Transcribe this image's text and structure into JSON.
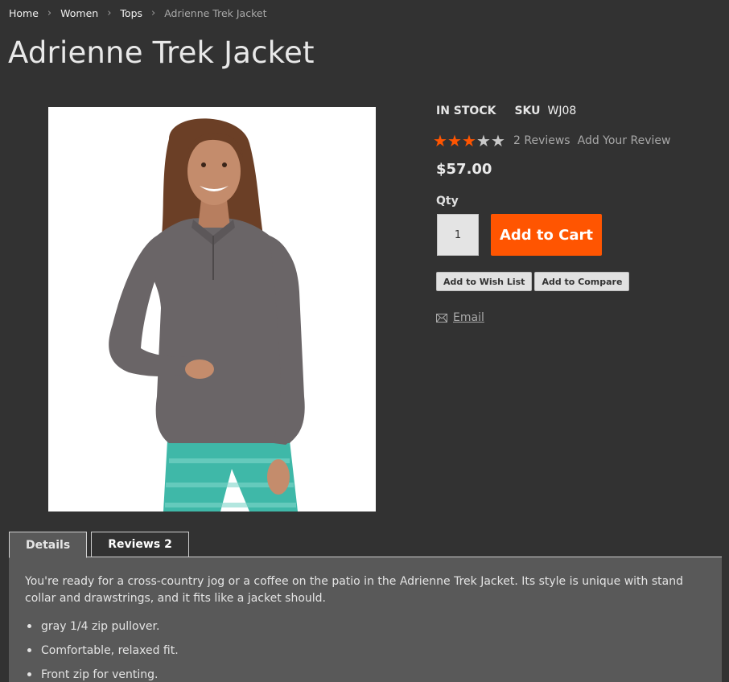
{
  "breadcrumb": {
    "items": [
      "Home",
      "Women",
      "Tops"
    ],
    "separator": "›",
    "current": "Adrienne Trek Jacket"
  },
  "product": {
    "title": "Adrienne Trek Jacket",
    "stock": "IN STOCK",
    "sku_label": "SKU",
    "sku": "WJ08",
    "rating": {
      "value": 3,
      "max": 5
    },
    "reviews_count_label": "2 Reviews",
    "add_review_label": "Add Your Review",
    "price": "$57.00",
    "qty_label": "Qty",
    "qty_value": "1",
    "add_to_cart_label": "Add to Cart",
    "add_to_wishlist_label": "Add to Wish List",
    "add_to_compare_label": "Add to Compare",
    "email_label": "Email"
  },
  "tabs": [
    {
      "label": "Details",
      "count": ""
    },
    {
      "label": "Reviews",
      "count": "2"
    }
  ],
  "details": {
    "description": "You're ready for a cross-country jog or a coffee on the patio in the Adrienne Trek Jacket. Its style is unique with stand collar and drawstrings, and it fits like a jacket should.",
    "bullets": [
      "gray 1/4 zip pullover.",
      "Comfortable, relaxed fit.",
      "Front zip for venting."
    ]
  },
  "colors": {
    "background": "#323232",
    "accent": "#ff5501",
    "panel": "#595959"
  },
  "icons": {
    "email": "envelope-icon",
    "star": "star-icon",
    "chevron": "chevron-right-icon"
  }
}
